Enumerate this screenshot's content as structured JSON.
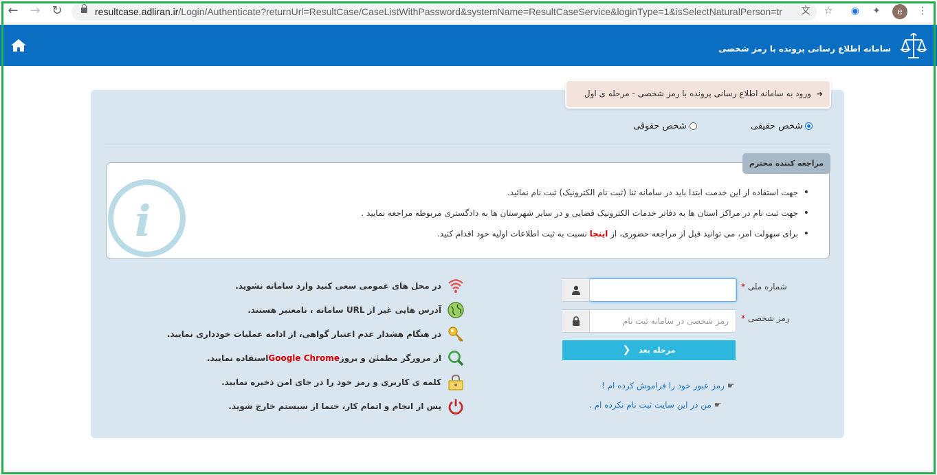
{
  "browser": {
    "url_domain": "resultcase.adliran.ir",
    "url_path": "/Login/Authenticate?returnUrl=ResultCase/CaseListWithPassword&systemName=ResultCaseService&loginType=1&isSelectNaturalPerson=true...",
    "profile_initial": "e"
  },
  "header": {
    "title": "سامانه اطلاع رسانی پرونده با رمز شخصی",
    "home_icon": "home-icon",
    "logo_icon": "scales-of-justice-icon",
    "background": "#0a6fc2"
  },
  "step": {
    "label": "ورود به سامانه اطلاع رسانی پرونده با رمز شخصی - مرحله ی اول"
  },
  "person_type": {
    "natural_label": "شخص حقیقی",
    "legal_label": "شخص حقوقی",
    "selected": "natural"
  },
  "notice": {
    "tag": "مراجعه کننده محترم",
    "items": [
      "جهت استفاده از این خدمت ابتدا باید در سامانه ثنا (ثبت نام الکترونیک) ثبت نام نمائید.",
      "جهت ثبت نام در مراکز استان ها به دفاتر خدمات الکترونیک قضایی و در سایر شهرستان ها به دادگستری مربوطه مراجعه نمایید ."
    ],
    "item3_before": "برای سهولت امر، می توانید قبل از مراجعه حضوری، از ",
    "item3_link": "اینجا",
    "item3_after": " نسبت به ثبت اطلاعات اولیه خود اقدام کنید."
  },
  "form": {
    "national_id_label": "شماره ملی",
    "national_id_value": "",
    "password_label": "رمز شخصی",
    "password_placeholder": "رمز شخصی در سامانه ثبت نام",
    "required_mark": "*",
    "next_button": "مرحله بعد",
    "forgot_link": "رمز عبور خود را فراموش کرده ام !",
    "not_registered_link": "من در این سایت ثبت نام نکرده ام ."
  },
  "tips": [
    {
      "icon": "wifi-warning-icon",
      "text": "در محل های عمومی سعی کنید وارد سامانه نشوید."
    },
    {
      "icon": "globe-icon",
      "text": "آدرس هایی غیر از URL سامانه ، نامعتبر هستند."
    },
    {
      "icon": "key-icon",
      "text": "در هنگام هشدار عدم اعتبار گواهی، از ادامه عملیات خودداری نمایید."
    },
    {
      "icon": "magnifier-icon",
      "text_before": "از مرورگر مطمئن و بروز ",
      "text_highlight": "Google Chrome",
      "text_after": " استفاده نمایید."
    },
    {
      "icon": "padlock-icon",
      "text": "کلمه ی کاربری و رمز خود را در جای امن ذخیره نمایید."
    },
    {
      "icon": "power-icon",
      "text": "پس از انجام و اتمام کار، حتما از سیستم خارج شوید."
    }
  ]
}
